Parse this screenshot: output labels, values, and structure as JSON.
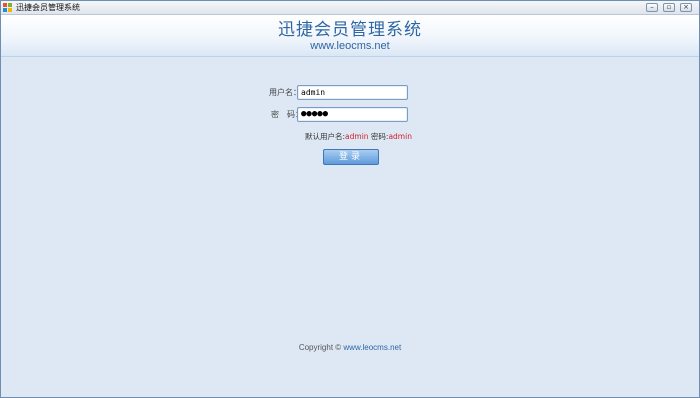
{
  "window": {
    "title": "迅捷会员管理系统",
    "minimize_glyph": "–",
    "restore_glyph": "▫",
    "close_glyph": "×"
  },
  "banner": {
    "title": "迅捷会员管理系统",
    "url": "www.leocms.net"
  },
  "login": {
    "username_label": "用户名：",
    "username_value": "admin",
    "password_label": "密　码：",
    "password_mask": "●●●●●",
    "hint_prefix": "默认用户名:",
    "hint_user": "admin",
    "hint_mid": " 密码:",
    "hint_pass": "admin",
    "login_button": "登录"
  },
  "footer": {
    "copyright_prefix": "Copyright © ",
    "copyright_link": "www.leocms.net"
  },
  "colors": {
    "accent": "#2e67a3",
    "hint_red": "#d0202a",
    "background": "#dde8f4"
  }
}
